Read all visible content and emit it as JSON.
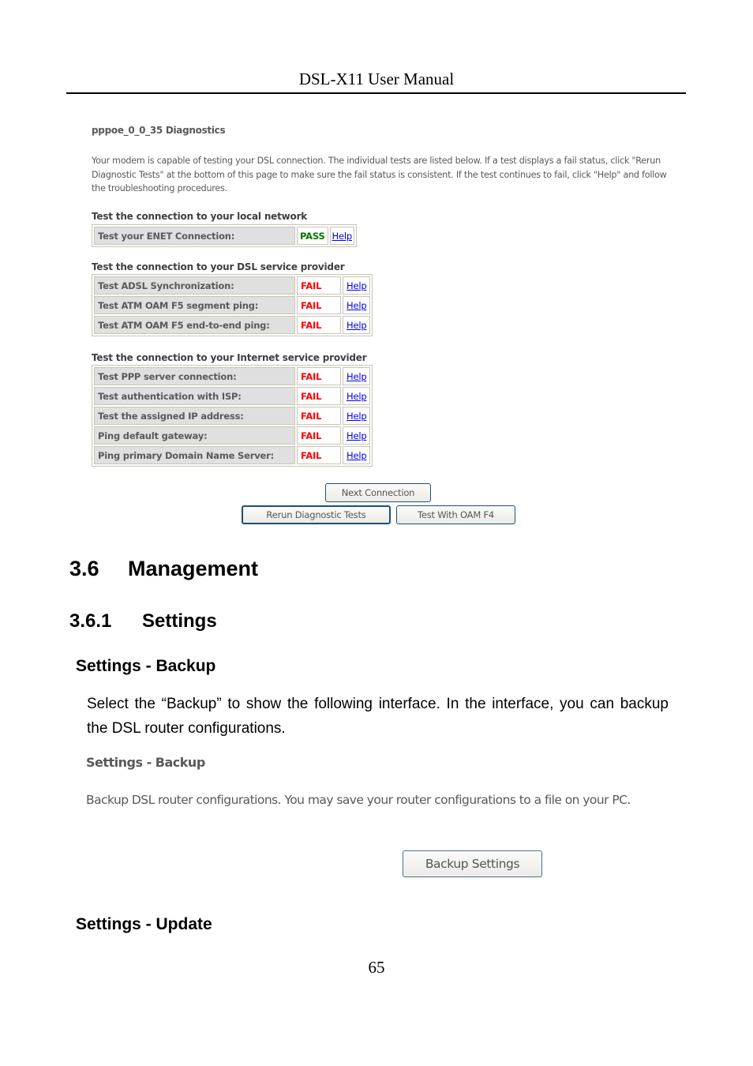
{
  "header": {
    "title": "DSL-X11 User Manual"
  },
  "diagnostics": {
    "title": "pppoe_0_0_35 Diagnostics",
    "description": "Your modem is capable of testing your DSL connection. The individual tests are listed below. If a test displays a fail status, click \"Rerun Diagnostic Tests\" at the bottom of this page to make sure the fail status is consistent. If the test continues to fail, click \"Help\" and follow the troubleshooting procedures.",
    "status_colors": {
      "pass": "#007700",
      "fail": "#ff0000"
    },
    "sections": [
      {
        "label": "Test the connection to your local network",
        "tests": [
          {
            "name": "Test your ENET Connection:",
            "status": "PASS",
            "help": "Help"
          }
        ]
      },
      {
        "label": "Test the connection to your DSL service provider",
        "tests": [
          {
            "name": "Test ADSL Synchronization:",
            "status": "FAIL",
            "help": "Help"
          },
          {
            "name": "Test ATM OAM F5 segment ping:",
            "status": "FAIL",
            "help": "Help"
          },
          {
            "name": "Test ATM OAM F5 end-to-end ping:",
            "status": "FAIL",
            "help": "Help"
          }
        ]
      },
      {
        "label": "Test the connection to your Internet service provider",
        "tests": [
          {
            "name": "Test PPP server connection:",
            "status": "FAIL",
            "help": "Help"
          },
          {
            "name": "Test authentication with ISP:",
            "status": "FAIL",
            "help": "Help"
          },
          {
            "name": "Test the assigned IP address:",
            "status": "FAIL",
            "help": "Help"
          },
          {
            "name": "Ping default gateway:",
            "status": "FAIL",
            "help": "Help"
          },
          {
            "name": "Ping primary Domain Name Server:",
            "status": "FAIL",
            "help": "Help"
          }
        ]
      }
    ],
    "buttons": {
      "next_connection": "Next Connection",
      "rerun": "Rerun Diagnostic Tests",
      "oam_f4": "Test With OAM F4"
    }
  },
  "doc": {
    "h1_num": "3.6",
    "h1_text": "Management",
    "h2_num": "3.6.1",
    "h2_text": "Settings",
    "backup_heading": "Settings - Backup",
    "backup_paragraph": "Select the “Backup” to show the following interface. In the interface, you can backup the DSL router configurations.",
    "update_heading": "Settings - Update"
  },
  "backup_ui": {
    "title": "Settings - Backup",
    "description": "Backup DSL router configurations. You may save your router configurations to a file on your PC.",
    "button": "Backup Settings"
  },
  "footer": {
    "page_number": "65"
  }
}
